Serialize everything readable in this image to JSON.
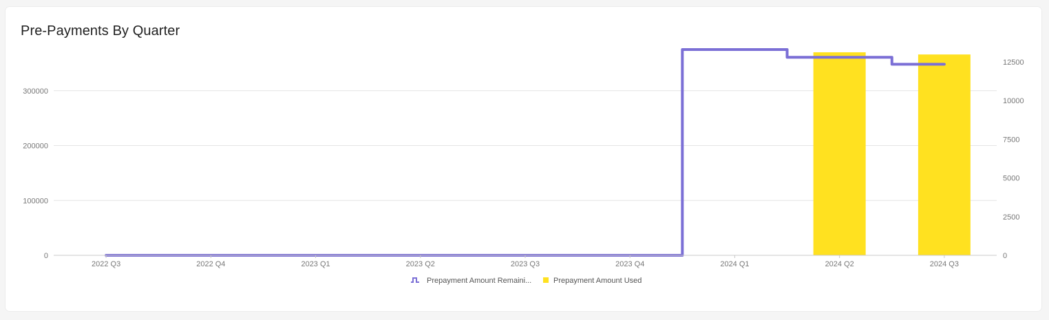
{
  "card": {
    "title": "Pre-Payments By Quarter"
  },
  "chart_data": {
    "type": "bar",
    "categories": [
      "2022 Q3",
      "2022 Q4",
      "2023 Q1",
      "2023 Q2",
      "2023 Q3",
      "2023 Q4",
      "2024 Q1",
      "2024 Q2",
      "2024 Q3"
    ],
    "series": [
      {
        "name": "Prepayment Amount Remaini...",
        "type": "step-line",
        "axis": "right",
        "color": "#7b6fd6",
        "values": [
          0,
          0,
          0,
          0,
          0,
          0,
          13300,
          12800,
          12350
        ]
      },
      {
        "name": "Prepayment Amount Used",
        "type": "bar",
        "axis": "left",
        "color": "#ffe120",
        "values": [
          0,
          0,
          0,
          0,
          0,
          0,
          0,
          370000,
          366000
        ]
      }
    ],
    "y_left": {
      "ticks": [
        "0",
        "100000",
        "200000",
        "300000"
      ],
      "range": [
        0,
        375000
      ]
    },
    "y_right": {
      "ticks": [
        "0",
        "2500",
        "5000",
        "7500",
        "10000",
        "12500"
      ],
      "range": [
        0,
        13300
      ]
    },
    "grid": true,
    "legend": "bottom-center"
  }
}
